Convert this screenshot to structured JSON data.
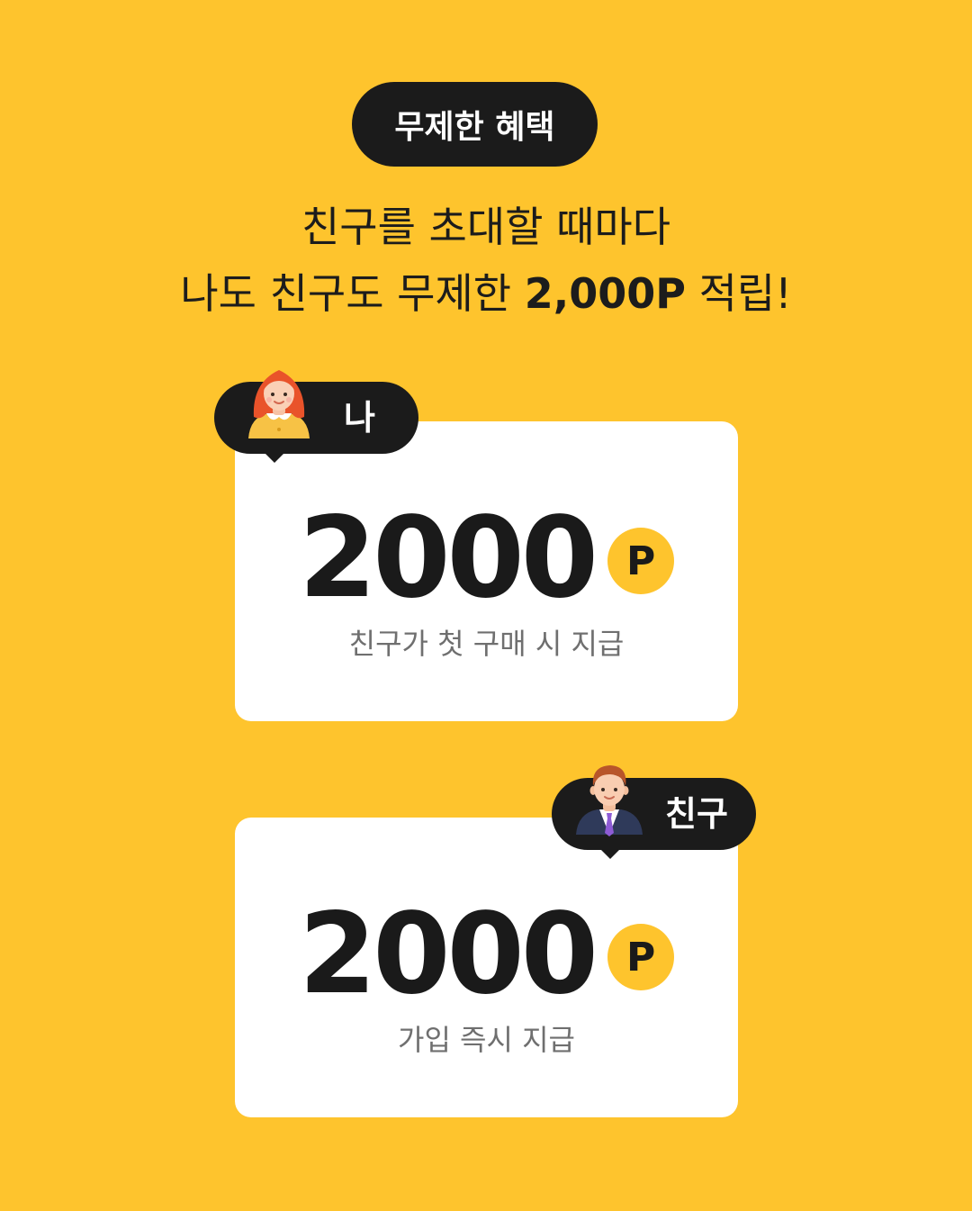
{
  "badge": {
    "label": "무제한 혜택"
  },
  "headline": {
    "line1": "친구를 초대할 때마다",
    "line2_prefix": "나도 친구도 무제한 ",
    "line2_bold": "2,000P",
    "line2_suffix": " 적립!"
  },
  "cards": [
    {
      "tag": "나",
      "avatar_icon": "woman-avatar-icon",
      "amount": "2000",
      "unit": "P",
      "caption": "친구가 첫 구매 시 지급"
    },
    {
      "tag": "친구",
      "avatar_icon": "man-avatar-icon",
      "amount": "2000",
      "unit": "P",
      "caption": "가입 즉시 지급"
    }
  ],
  "colors": {
    "background": "#FEC42D",
    "dark": "#1B1B1B",
    "card": "#FFFFFF",
    "caption": "#6F6F6F"
  }
}
